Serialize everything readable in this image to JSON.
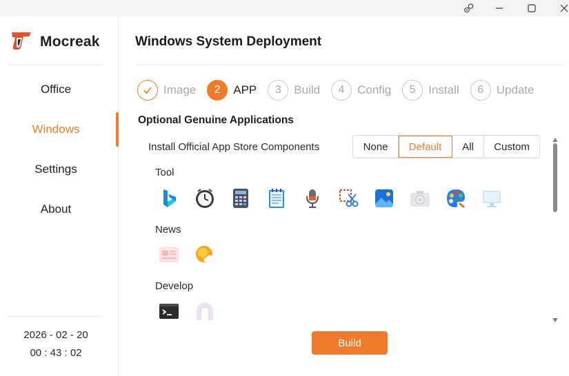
{
  "app": {
    "name": "Mocreak"
  },
  "window_controls": [
    "feedback-icon",
    "minimize-icon",
    "maximize-icon",
    "close-icon"
  ],
  "sidebar": {
    "items": [
      {
        "label": "Office",
        "active": false
      },
      {
        "label": "Windows",
        "active": true
      },
      {
        "label": "Settings",
        "active": false
      },
      {
        "label": "About",
        "active": false
      }
    ],
    "date": "2026 - 02 - 20",
    "time": "00 : 43 : 02"
  },
  "main": {
    "title": "Windows System Deployment",
    "steps": [
      {
        "marker": "✓",
        "label": "Image",
        "state": "done"
      },
      {
        "marker": "2",
        "label": "APP",
        "state": "current"
      },
      {
        "marker": "3",
        "label": "Build",
        "state": "pending"
      },
      {
        "marker": "4",
        "label": "Config",
        "state": "pending"
      },
      {
        "marker": "5",
        "label": "Install",
        "state": "pending"
      },
      {
        "marker": "6",
        "label": "Update",
        "state": "pending"
      }
    ],
    "section_title": "Optional Genuine Applications",
    "store_label": "Install Official App Store Components",
    "store_options": [
      "None",
      "Default",
      "All",
      "Custom"
    ],
    "store_selected": "Default",
    "groups": [
      {
        "label": "Tool",
        "icons": [
          "bing-icon",
          "clock-icon",
          "calculator-icon",
          "notepad-icon",
          "voice-recorder-icon",
          "snipping-tool-icon",
          "photos-icon",
          "camera-icon",
          "paint-icon",
          "remote-desktop-icon"
        ]
      },
      {
        "label": "News",
        "icons": [
          "news-icon",
          "weather-icon"
        ]
      },
      {
        "label": "Develop",
        "icons": [
          "terminal-icon",
          "dev-home-icon"
        ]
      }
    ],
    "build_label": "Build"
  },
  "colors": {
    "accent": "#f07b2d",
    "muted": "#a8a8a8",
    "divider": "#ececec"
  }
}
